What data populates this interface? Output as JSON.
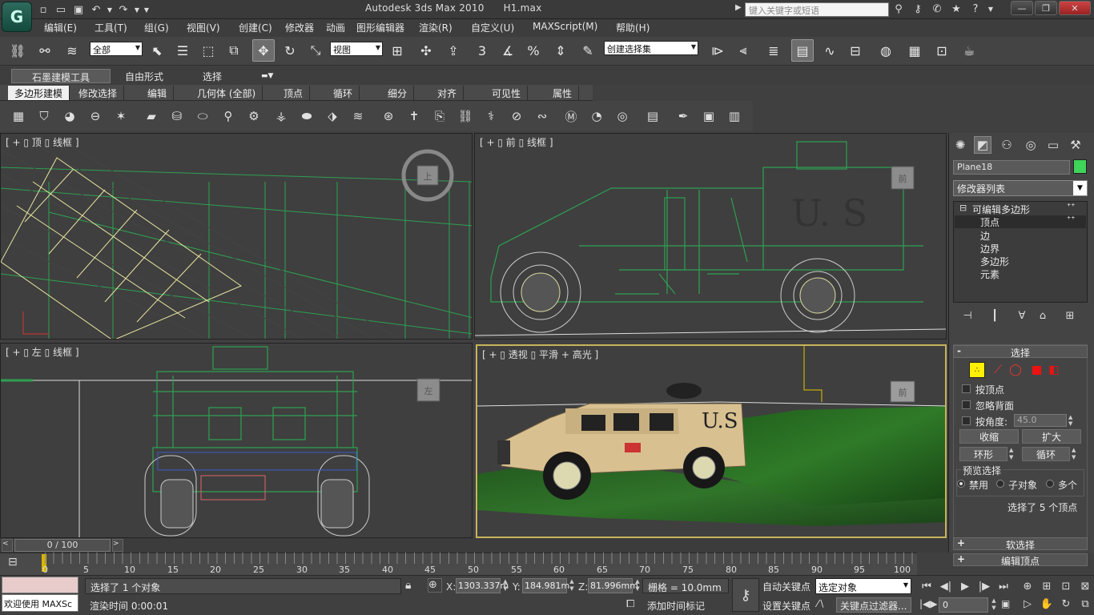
{
  "app": {
    "title": "Autodesk 3ds Max  2010",
    "file": "H1.max",
    "logo": "G",
    "search_placeholder": "键入关键字或短语"
  },
  "quick_access": [
    "new-file-icon",
    "open-folder-icon",
    "save-icon",
    "undo-icon",
    "redo-icon",
    "dropdown-icon"
  ],
  "menus": [
    "编辑(E)",
    "工具(T)",
    "组(G)",
    "视图(V)",
    "创建(C)",
    "修改器",
    "动画",
    "图形编辑器",
    "渲染(R)",
    "自定义(U)",
    "MAXScript(M)",
    "帮助(H)"
  ],
  "toolbar": {
    "selection_filter": "全部",
    "ref_coord": "视图",
    "named_selection": "创建选择集",
    "snap_angle": "3"
  },
  "ribbon": {
    "tabs": [
      "石墨建模工具",
      "自由形式",
      "选择"
    ],
    "subtabs": [
      "多边形建模",
      "修改选择",
      "编辑",
      "几何体 (全部)",
      "顶点",
      "循环",
      "细分",
      "对齐",
      "可见性",
      "属性"
    ]
  },
  "viewports": {
    "top": {
      "label": "[ + ▯ 顶 ▯ 线框 ]",
      "cube": "上"
    },
    "front": {
      "label": "[ + ▯ 前 ▯ 线框 ]",
      "cube": "前",
      "decal": "U. S"
    },
    "left": {
      "label": "[ + ▯ 左 ▯ 线框 ]",
      "cube": "左"
    },
    "persp": {
      "label": "[ + ▯ 透视 ▯ 平滑 + 高光 ]",
      "cube": "前",
      "decal": "U.S"
    }
  },
  "command_panel": {
    "object_name": "Plane18",
    "object_color": "#3fd45a",
    "modifier_list": "修改器列表",
    "stack": {
      "root": "可编辑多边形",
      "items": [
        "顶点",
        "边",
        "边界",
        "多边形",
        "元素"
      ],
      "selected": "顶点"
    },
    "selection": {
      "title": "选择",
      "by_vertex": "按顶点",
      "ignore_backfacing": "忽略背面",
      "by_angle": "按角度:",
      "angle_value": "45.0",
      "shrink": "收缩",
      "grow": "扩大",
      "ring": "环形",
      "loop": "循环",
      "preview_title": "预览选择",
      "preview_options": [
        "禁用",
        "子对象",
        "多个"
      ],
      "status": "选择了 5 个顶点"
    },
    "soft_selection": "软选择",
    "edit_vertices": "编辑顶点"
  },
  "timeline": {
    "position": "0 / 100",
    "ticks": [
      "0",
      "5",
      "10",
      "15",
      "20",
      "25",
      "30",
      "35",
      "40",
      "45",
      "50",
      "55",
      "60",
      "65",
      "70",
      "75",
      "80",
      "85",
      "90",
      "95",
      "100"
    ]
  },
  "status": {
    "maxscript": "欢迎使用 MAXSc",
    "selection": "选择了 1 个对象",
    "render_time": "渲染时间  0:00:01",
    "x": "1303.337m",
    "y": "184.981m",
    "z": "81.996mm",
    "grid": "栅格 = 10.0mm",
    "add_time_tag": "添加时间标记",
    "auto_key": "自动关键点",
    "set_key": "设置关键点",
    "key_mode": "选定对象",
    "key_filters": "关键点过滤器...",
    "frame": "0"
  }
}
